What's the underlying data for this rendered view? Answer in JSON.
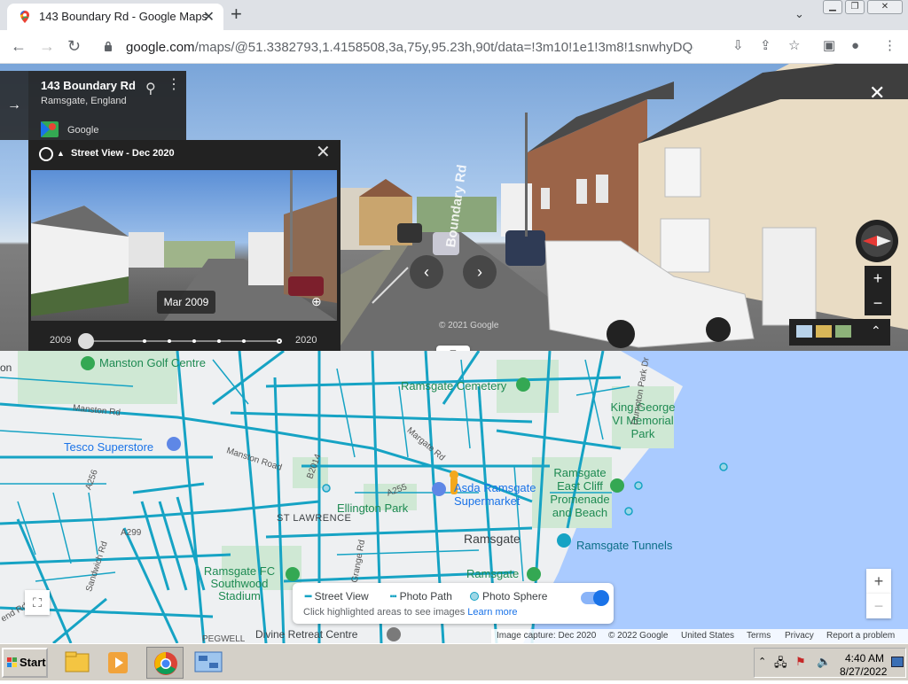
{
  "browser": {
    "tab_title": "143 Boundary Rd - Google Maps",
    "url_host": "google.com",
    "url_path": "/maps/@51.3382793,1.4158508,3a,75y,95.23h,90t/data=!3m10!1e1!3m8!1snwhyDQonbKupvsp..."
  },
  "address_card": {
    "name": "143 Boundary Rd",
    "place": "Ramsgate, England",
    "contributor": "Google"
  },
  "time_machine": {
    "header": "Street View - Dec 2020",
    "thumbnail_date": "Mar 2009",
    "year_start": "2009",
    "year_end": "2020"
  },
  "pano": {
    "road_label": "Boundary Rd",
    "copyright": "© 2021 Google"
  },
  "map_labels": {
    "manston_golf": "Manston Golf Centre",
    "ramsgate_cemetery": "Ramsgate Cemetery",
    "king_george": "King George VI Memorial Park",
    "tesco": "Tesco Superstore",
    "manston_road": "Manston Road",
    "manston_rd": "Manston Rd",
    "margate_rd": "Margate Rd",
    "asda": "Asda Ramsgate Supermarket",
    "east_cliff": "Ramsgate East Cliff Promenade and Beach",
    "ellington": "Ellington Park",
    "st_lawrence": "ST LAWRENCE",
    "ramsgate": "Ramsgate",
    "tunnels": "Ramsgate Tunnels",
    "ramsgate_fc": "Ramsgate FC Southwood Stadium",
    "ramsgate_poi": "Ramsgate",
    "divine": "Divine Retreat Centre",
    "a256": "A256",
    "a255": "A255",
    "a299": "A299",
    "b2014": "B2014",
    "sandwich_rd": "Sandwich Rd",
    "grange_rd": "Grange Rd",
    "dumpton": "Dumpton Park Dr",
    "on": "on",
    "end_rd": "end Rd",
    "pegwell": "PEGWELL"
  },
  "legend": {
    "street_view": "Street View",
    "photo_path": "Photo Path",
    "photo_sphere": "Photo Sphere",
    "hint": "Click highlighted areas to see images",
    "learn_more": "Learn more"
  },
  "footer": {
    "capture": "Image capture: Dec 2020",
    "copyright": "© 2022 Google",
    "country": "United States",
    "terms": "Terms",
    "privacy": "Privacy",
    "report": "Report a problem"
  },
  "taskbar": {
    "start": "Start",
    "time": "4:40 AM",
    "date": "8/27/2022"
  },
  "colors": {
    "coverage": "#16a3c4",
    "water": "#aacbff",
    "park": "#cfe8d4",
    "map_bg": "#eef0f2"
  }
}
